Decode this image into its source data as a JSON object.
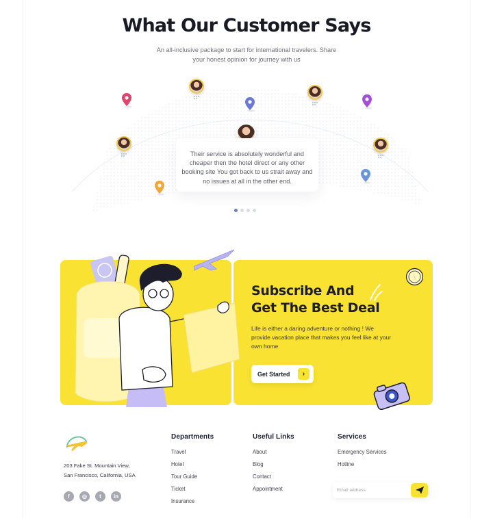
{
  "testimonials": {
    "title": "What Our Customer Says",
    "subtitle": "An all-inclusive package to start for international travelers. Share your honest opinion for journey with us",
    "quote": "Their service is absolutely wonderful and cheaper then the hotel direct or any other booking site You got back to us strait away and no issues at all in the other end.",
    "carousel": {
      "total": 4,
      "active_index": 0
    },
    "pin_colors": [
      "#e0436b",
      "#6b78d8",
      "#a44ed8",
      "#f1a73a",
      "#6a96d8"
    ]
  },
  "subscribe": {
    "heading_line1": "Subscribe And",
    "heading_line2": "Get The Best Deal",
    "text": "Life is either a daring adventure or nothing ! We provide vacation place that makes you feel like at your own home",
    "cta_label": "Get Started",
    "cta_icon": "chevron-right-icon",
    "accent_color": "#f9e231"
  },
  "footer": {
    "address_line1": "203 Fake St. Mountain View,",
    "address_line2": "San Francisco, California, USA",
    "socials": [
      "facebook-icon",
      "instagram-icon",
      "twitter-icon",
      "linkedin-icon"
    ],
    "departments": {
      "title": "Departments",
      "links": [
        "Travel",
        "Hotel",
        "Tour Guide",
        "Ticket",
        "Insurance"
      ]
    },
    "useful_links": {
      "title": "Useful Links",
      "links": [
        "About",
        "Blog",
        "Contact",
        "Appointment"
      ]
    },
    "services": {
      "title": "Services",
      "links": [
        "Emergency Services",
        "Hotline"
      ]
    },
    "newsletter": {
      "placeholder": "Email address",
      "send_icon": "paper-plane-icon"
    }
  }
}
